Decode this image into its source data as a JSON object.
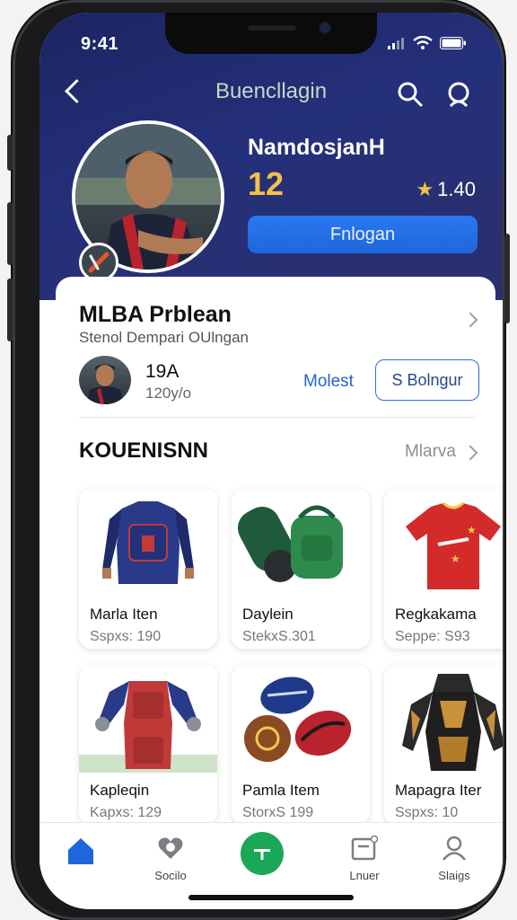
{
  "status": {
    "time": "9:41"
  },
  "header": {
    "title": "Buencllagin"
  },
  "profile": {
    "name": "NamdosjanH",
    "level": "12",
    "stars": "1.40",
    "follow_label": "Fnlogan"
  },
  "section": {
    "title": "MLBA Prblean",
    "subtitle": "Stenol Dempari OUlngan",
    "count": "19A",
    "count_sub": "120y/o",
    "link": "Molest",
    "button": "S Bolngur"
  },
  "collection": {
    "title": "KOUENISNN",
    "more": "Mlarva",
    "items": [
      {
        "name": "Marla Iten",
        "price": "Sspxs: 190",
        "icon": "padded-vest"
      },
      {
        "name": "Daylein",
        "price": "StekxS.301",
        "icon": "bags"
      },
      {
        "name": "Regkakama",
        "price": "Seppe: S93",
        "icon": "red-jersey"
      },
      {
        "name": "Kapleqin",
        "price": "Kapxs: 129",
        "icon": "armor"
      },
      {
        "name": "Pamla Item",
        "price": "StorxS 199",
        "icon": "balls"
      },
      {
        "name": "Mapagra Iter",
        "price": "Sspxs: 10",
        "icon": "dark-armor"
      }
    ]
  },
  "tabs": [
    {
      "label": "",
      "icon": "home-icon"
    },
    {
      "label": "Socilo",
      "icon": "heart-icon"
    },
    {
      "label": "",
      "icon": "add-icon"
    },
    {
      "label": "Lnuer",
      "icon": "inbox-icon"
    },
    {
      "label": "Slaigs",
      "icon": "user-icon"
    }
  ],
  "colors": {
    "accent": "#1F66DB",
    "hero": "#1C2462",
    "gold": "#F3C245",
    "fab": "#1AA856"
  }
}
